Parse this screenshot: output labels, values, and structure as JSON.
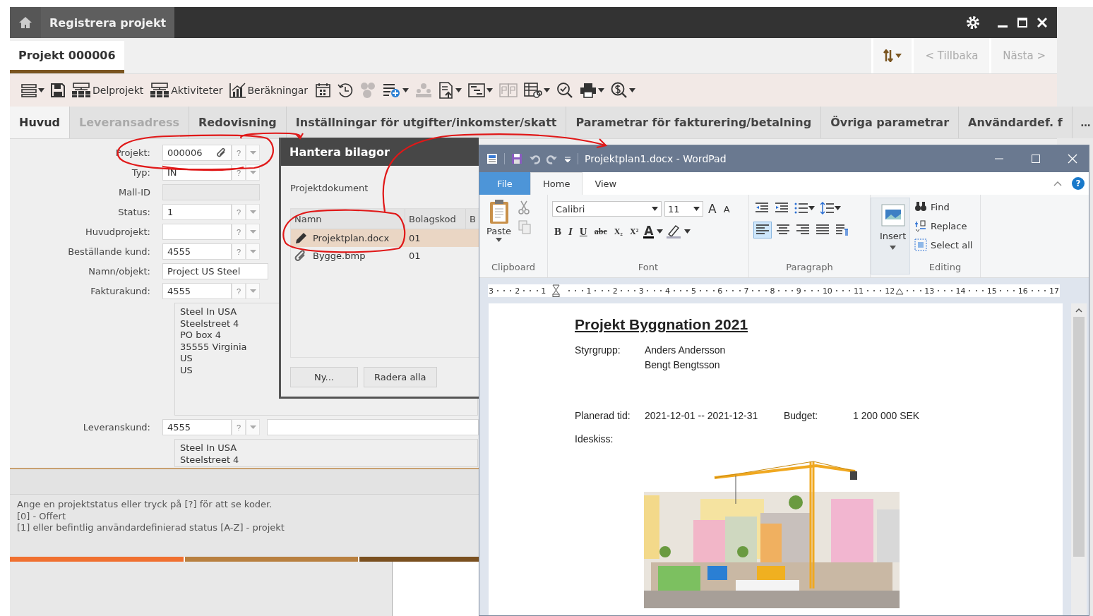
{
  "app": {
    "title": "Registrera projekt",
    "document_tab": {
      "label": "Projekt 000006",
      "selected": true
    },
    "nav": {
      "back": "< Tillbaka",
      "next": "Nästa >",
      "disabled": true
    },
    "toolbar": [
      {
        "disabled": false
      },
      {
        "disabled": false
      },
      {
        "label": "Delprojekt",
        "disabled": false
      },
      {
        "label": "Aktiviteter",
        "disabled": false
      },
      {
        "label": "Beräkningar",
        "disabled": false
      },
      {
        "disabled": false
      },
      {
        "disabled": false
      },
      {
        "disabled": true
      },
      {
        "disabled": false
      },
      {
        "disabled": true
      },
      {
        "disabled": false
      },
      {
        "disabled": false
      },
      {
        "disabled": true
      },
      {
        "disabled": false
      },
      {
        "disabled": false
      },
      {
        "disabled": false
      },
      {
        "disabled": false
      }
    ],
    "tabs": [
      {
        "label": "Huvud",
        "selected": true,
        "disabled": false
      },
      {
        "label": "Leveransadress",
        "selected": false,
        "disabled": true
      },
      {
        "label": "Redovisning",
        "selected": false,
        "disabled": false
      },
      {
        "label": "Inställningar för utgifter/inkomster/skatt",
        "selected": false,
        "disabled": false
      },
      {
        "label": "Parametrar för fakturering/betalning",
        "selected": false,
        "disabled": false
      },
      {
        "label": "Övriga parametrar",
        "selected": false,
        "disabled": false
      },
      {
        "label": "Användardef. f",
        "selected": false,
        "disabled": false
      }
    ],
    "tabs_more": "…",
    "fields": [
      {
        "label": "Projekt:",
        "kind": "lookup",
        "value": "000006",
        "help": "?",
        "attachment": true
      },
      {
        "label": "Typ:",
        "kind": "lookup",
        "value": "IN",
        "help": "?"
      },
      {
        "label": "Mall-ID",
        "kind": "disabled"
      },
      {
        "label": "Status:",
        "kind": "lookup",
        "value": "1",
        "help": "?"
      },
      {
        "label": "Huvudprojekt:",
        "kind": "lookup",
        "help": "?"
      },
      {
        "label": "Beställande kund:",
        "kind": "lookup",
        "value": "4555",
        "help": "?"
      },
      {
        "label": "Namn/objekt:",
        "kind": "text",
        "value": "Project US Steel"
      },
      {
        "label": "Fakturakund:",
        "kind": "lookup",
        "value": "4555",
        "help": "?"
      },
      {
        "kind": "address",
        "lines": [
          "Steel In USA",
          "Steelstreet 4",
          "PO box 4",
          "35555 Virginia",
          "US",
          "US"
        ]
      },
      {
        "label": "Leveranskund:",
        "kind": "lookup",
        "value": "4555",
        "help": "?",
        "extra_field": true
      },
      {
        "kind": "address",
        "lines": [
          "Steel In USA",
          "Steelstreet 4"
        ]
      }
    ],
    "hint": [
      "Ange en projektstatus eller tryck på [?] för att se koder.",
      "[0] - Offert",
      "[1] eller befintlig användardefinierad status [A-Z] - projekt"
    ]
  },
  "dialog": {
    "title": "Hantera bilagor",
    "section": "Projektdokument",
    "columns": [
      "Namn",
      "Bolagskod",
      "B"
    ],
    "rows": [
      {
        "kind": "editing",
        "name": "Projektplan.docx",
        "code": "01",
        "selected": true
      },
      {
        "kind": "attachment",
        "name": "Bygge.bmp",
        "code": "01",
        "selected": false
      }
    ],
    "buttons": [
      "Ny...",
      "Radera alla"
    ]
  },
  "wordpad": {
    "title": "Projektplan1.docx - WordPad",
    "ribbon_tabs": [
      {
        "kind": "file",
        "label": "File",
        "selected": false
      },
      {
        "kind": "tab",
        "label": "Home",
        "selected": true
      },
      {
        "kind": "tab",
        "label": "View",
        "selected": false
      }
    ],
    "help": "?",
    "clipboard": {
      "paste": "Paste",
      "group": "Clipboard"
    },
    "font": {
      "family": "Calibri",
      "size": "11",
      "grow": "A",
      "shrink": "A",
      "format": [
        "B",
        "I",
        "U",
        "abc",
        "X₂",
        "X²"
      ],
      "color_button": "A",
      "group": "Font"
    },
    "paragraph": {
      "group": "Paragraph"
    },
    "insert": {
      "label": "Insert"
    },
    "editing": {
      "items": [
        "Find",
        "Replace",
        "Select all"
      ],
      "group": "Editing"
    },
    "ruler": [
      "3",
      "2",
      "1",
      "1",
      "2",
      "3",
      "4",
      "5",
      "6",
      "7",
      "8",
      "9",
      "10",
      "11",
      "12",
      "13",
      "14",
      "15",
      "16",
      "17"
    ],
    "document": {
      "title": "Projekt Byggnation 2021",
      "steering_label": "Styrgrupp:",
      "steering": [
        "Anders Andersson",
        "Bengt Bengtsson"
      ],
      "time_label": "Planerad tid:",
      "time": "2021-12-01 -- 2021-12-31",
      "budget_label": "Budget:",
      "budget": "1 200 000 SEK",
      "sketch_label": "Ideskiss:"
    }
  }
}
